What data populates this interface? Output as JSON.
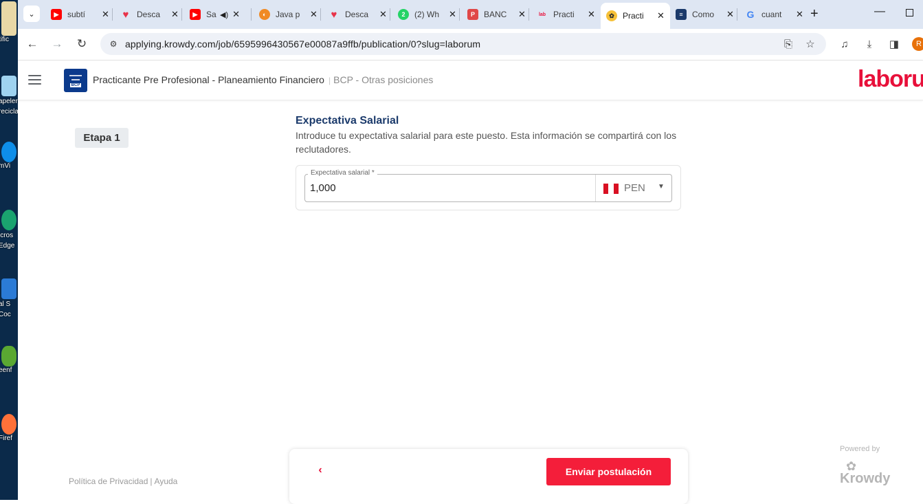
{
  "desktop": {
    "items": [
      {
        "label": "tific",
        "color": "#e9d8a6",
        "icon": "folder-icon"
      },
      {
        "label": "apelera reciclaje",
        "color": "#9fd3f0",
        "icon": "recycle-bin-icon"
      },
      {
        "label": "mVi",
        "color": "#0e8ee9",
        "icon": "teamviewer-icon"
      },
      {
        "label": "icros Edge",
        "color": "#1aa36f",
        "icon": "edge-icon"
      },
      {
        "label": "al S Coc",
        "color": "#2b7bd6",
        "icon": "vscode-icon"
      },
      {
        "label": "eenf",
        "color": "#5aa832",
        "icon": "greenfoot-icon"
      },
      {
        "label": "Firef",
        "color": "#ff7139",
        "icon": "firefox-icon"
      }
    ]
  },
  "tabs": [
    {
      "title": "subtí",
      "favicon": "youtube-icon",
      "color": "#ff0000",
      "glyph": "▶"
    },
    {
      "title": "Desca",
      "favicon": "heart-icon",
      "color": "#e8334a",
      "glyph": "♥"
    },
    {
      "title": "Sa",
      "favicon": "youtube-icon",
      "color": "#ff0000",
      "glyph": "▶"
    },
    {
      "title": "Java p",
      "favicon": "java-icon",
      "color": "#f08a24",
      "glyph": "◐"
    },
    {
      "title": "Desca",
      "favicon": "heart-icon",
      "color": "#e8334a",
      "glyph": "♥"
    },
    {
      "title": "(2) Wh",
      "favicon": "whatsapp-icon",
      "color": "#25d366",
      "glyph": "2"
    },
    {
      "title": "BANC",
      "favicon": "pdf-icon",
      "color": "#e04848",
      "glyph": "P"
    },
    {
      "title": "Practi",
      "favicon": "laborum-icon",
      "color": "#e8103a",
      "glyph": "l"
    },
    {
      "title": "Practi",
      "favicon": "bee-icon",
      "color": "#2b2b2b",
      "glyph": "✿"
    },
    {
      "title": "Como",
      "favicon": "doc-icon",
      "color": "#1b3a6b",
      "glyph": "≡"
    },
    {
      "title": "cuant",
      "favicon": "google-icon",
      "color": "#4285f4",
      "glyph": "G"
    }
  ],
  "browser": {
    "url": "applying.krowdy.com/job/6595996430567e00087a9ffb/publication/0?slug=laborum",
    "profile_initial": "R"
  },
  "header": {
    "job_title": "Practicante Pre Profesional - Planeamiento Financiero",
    "job_subtitle": "BCP - Otras posiciones",
    "brand": "laborum",
    "brand_color": "#e8103a"
  },
  "stage": {
    "label": "Etapa 1"
  },
  "section": {
    "title": "Expectativa Salarial",
    "description": "Introduce tu expectativa salarial para este puesto. Esta información se compartirá con los reclutadores."
  },
  "salary_field": {
    "label": "Expectativa salarial *",
    "value": "1,000",
    "currency": "PEN"
  },
  "footer": {
    "privacy": "Política de Privacidad",
    "help": "Ayuda",
    "powered_by": "Powered by",
    "powered_brand": "Krowdy"
  },
  "actions": {
    "back_glyph": "‹",
    "submit_label": "Enviar postulación",
    "submit_color": "#f41e3a"
  }
}
